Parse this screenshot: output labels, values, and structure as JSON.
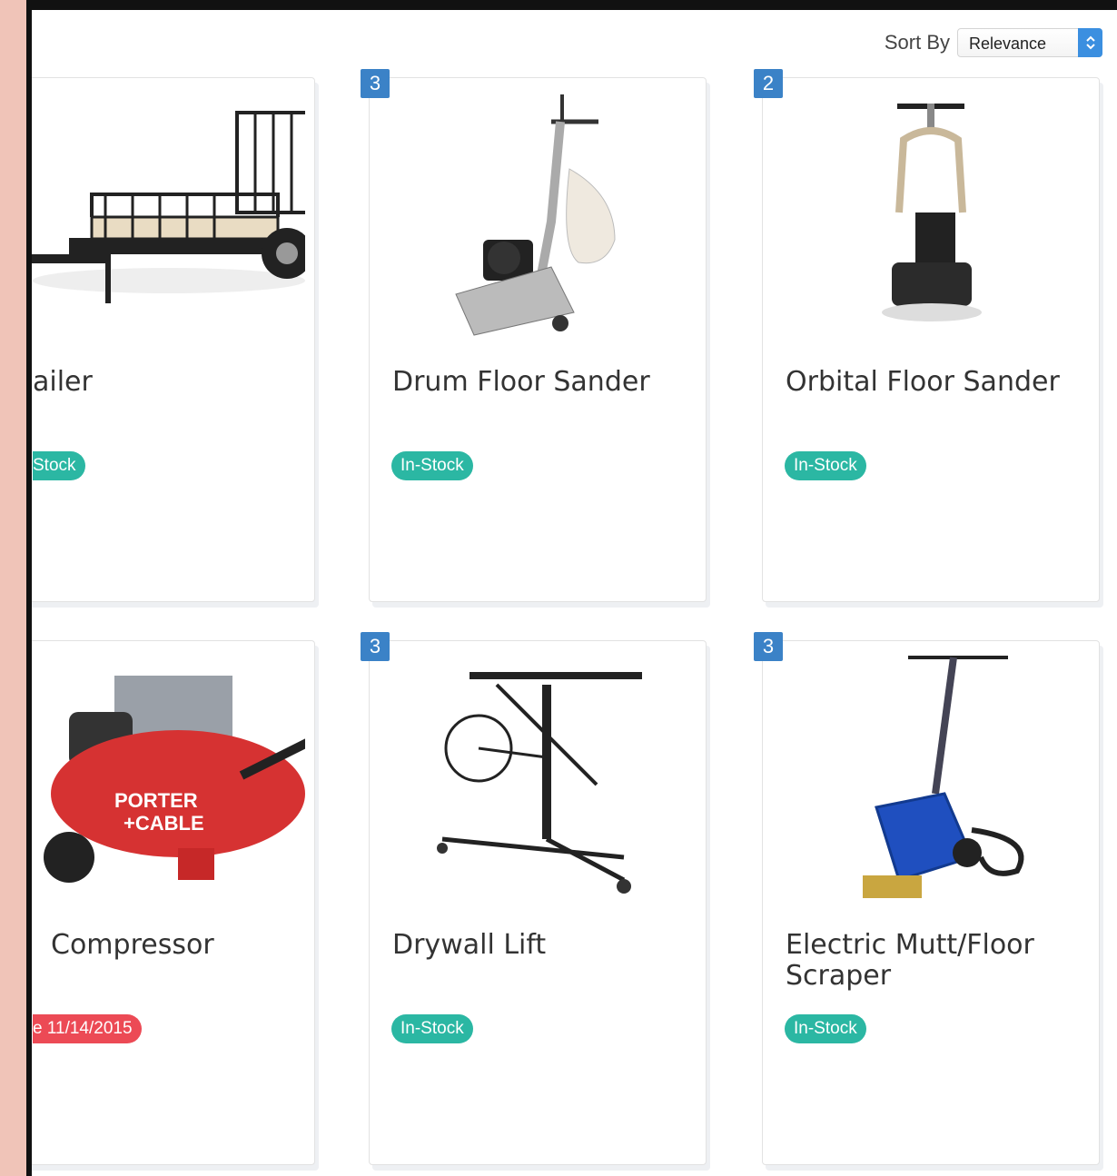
{
  "sort": {
    "label": "Sort By",
    "selected": "Relevance"
  },
  "products": [
    {
      "title": "ailer",
      "status": "Stock",
      "status_type": "instock",
      "badge": ""
    },
    {
      "title": "Drum Floor Sander",
      "status": "In-Stock",
      "status_type": "instock",
      "badge": "3"
    },
    {
      "title": "Orbital Floor Sander",
      "status": "In-Stock",
      "status_type": "instock",
      "badge": "2"
    },
    {
      "title": "Compressor",
      "status": "e 11/14/2015",
      "status_type": "due",
      "badge": ""
    },
    {
      "title": "Drywall Lift",
      "status": "In-Stock",
      "status_type": "instock",
      "badge": "3"
    },
    {
      "title": "Electric Mutt/Floor Scraper",
      "status": "In-Stock",
      "status_type": "instock",
      "badge": "3"
    }
  ],
  "colors": {
    "badge": "#3b82c7",
    "instock": "#2bb7a3",
    "due": "#ec4a55",
    "select_button": "#3b8fe0",
    "sidebar_strip": "#f0c4b8"
  }
}
